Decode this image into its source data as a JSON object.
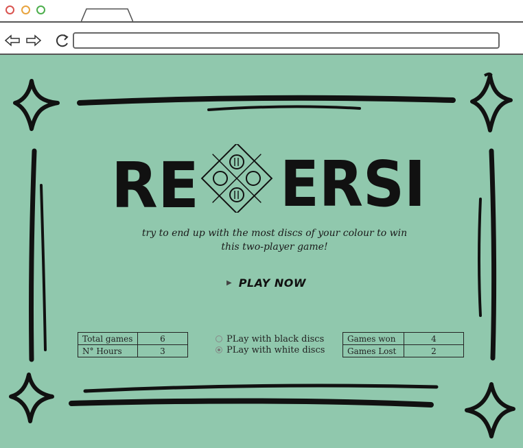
{
  "browser": {
    "url": "",
    "dots": [
      {
        "name": "close-dot",
        "color": "#d9534f"
      },
      {
        "name": "minimize-dot",
        "color": "#e8a33d"
      },
      {
        "name": "maximize-dot",
        "color": "#4cae4c"
      }
    ],
    "back_icon": "back-arrow-icon",
    "forward_icon": "forward-arrow-icon",
    "reload_icon": "reload-icon"
  },
  "game": {
    "title_left": "RE",
    "title_right": "ERSI",
    "subtitle_line1": "try to end up with the most discs of your colour to win",
    "subtitle_line2": "this two-player game!",
    "play_label": "PLAY NOW",
    "background_color": "#90c8ad"
  },
  "stats_left": {
    "rows": [
      {
        "label": "Total games",
        "value": "6"
      },
      {
        "label": "N° Hours",
        "value": "3"
      }
    ]
  },
  "disc_choice": {
    "options": [
      {
        "label": "PLay with black discs",
        "selected": false
      },
      {
        "label": "PLay with white discs",
        "selected": true
      }
    ]
  },
  "stats_right": {
    "rows": [
      {
        "label": "Games won",
        "value": "4"
      },
      {
        "label": "Games Lost",
        "value": "2"
      }
    ]
  }
}
